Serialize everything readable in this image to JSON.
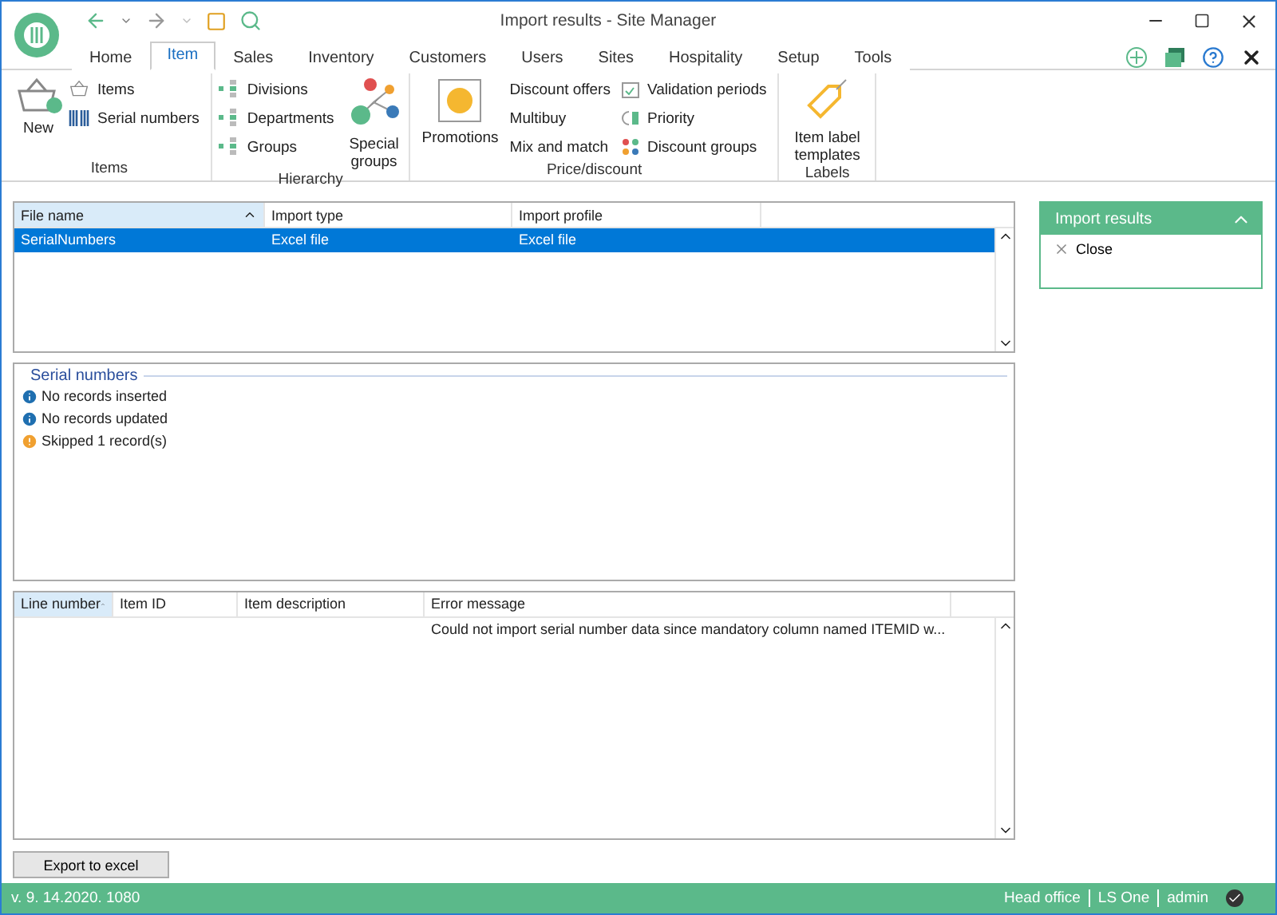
{
  "window": {
    "title": "Import results - Site Manager"
  },
  "tabs": [
    {
      "label": "Home",
      "selected": false
    },
    {
      "label": "Item",
      "selected": true
    },
    {
      "label": "Sales",
      "selected": false
    },
    {
      "label": "Inventory",
      "selected": false
    },
    {
      "label": "Customers",
      "selected": false
    },
    {
      "label": "Users",
      "selected": false
    },
    {
      "label": "Sites",
      "selected": false
    },
    {
      "label": "Hospitality",
      "selected": false
    },
    {
      "label": "Setup",
      "selected": false
    },
    {
      "label": "Tools",
      "selected": false
    }
  ],
  "ribbon": [
    {
      "label": "Items",
      "columns": [
        {
          "kind": "large",
          "label": "New"
        },
        {
          "kind": "small",
          "items": [
            "Items",
            "Serial numbers"
          ]
        }
      ]
    },
    {
      "label": "Hierarchy",
      "columns": [
        {
          "kind": "small",
          "items": [
            "Divisions",
            "Departments",
            "Groups"
          ]
        },
        {
          "kind": "large",
          "label": "Special groups"
        }
      ]
    },
    {
      "label": "Price/discount",
      "columns": [
        {
          "kind": "large",
          "label": "Promotions"
        },
        {
          "kind": "small",
          "items": [
            "Discount offers",
            "Multibuy",
            "Mix and match"
          ]
        },
        {
          "kind": "small",
          "items": [
            "Validation periods",
            "Priority",
            "Discount groups"
          ]
        }
      ]
    },
    {
      "label": "Labels",
      "columns": [
        {
          "kind": "large",
          "label": "Item label templates"
        }
      ]
    }
  ],
  "files": {
    "columns": [
      {
        "label": "File name",
        "sorted": true
      },
      {
        "label": "Import type",
        "sorted": false
      },
      {
        "label": "Import profile",
        "sorted": false
      }
    ],
    "rows": [
      {
        "cells": [
          "SerialNumbers",
          "Excel file",
          "Excel file"
        ],
        "selected": true
      }
    ]
  },
  "summary": {
    "title": "Serial numbers",
    "messages": [
      {
        "kind": "info",
        "text": "No records inserted"
      },
      {
        "kind": "info",
        "text": "No records updated"
      },
      {
        "kind": "warning",
        "text": "Skipped 1 record(s)"
      }
    ]
  },
  "errors": {
    "columns": [
      {
        "label": "Line number",
        "sorted": true
      },
      {
        "label": "Item ID",
        "sorted": false
      },
      {
        "label": "Item description",
        "sorted": false
      },
      {
        "label": "Error message",
        "sorted": false
      }
    ],
    "rows": [
      {
        "cells": [
          "",
          "",
          "",
          "Could not import serial number data since mandatory column named ITEMID w..."
        ],
        "selected": false
      }
    ]
  },
  "export_button": "Export to excel",
  "side_panel": {
    "title": "Import results",
    "expanded": true,
    "actions": [
      "Close"
    ]
  },
  "status_bar": {
    "version": "v. 9. 14.2020. 1080",
    "items": [
      "Head office",
      "LS One",
      "admin"
    ]
  }
}
